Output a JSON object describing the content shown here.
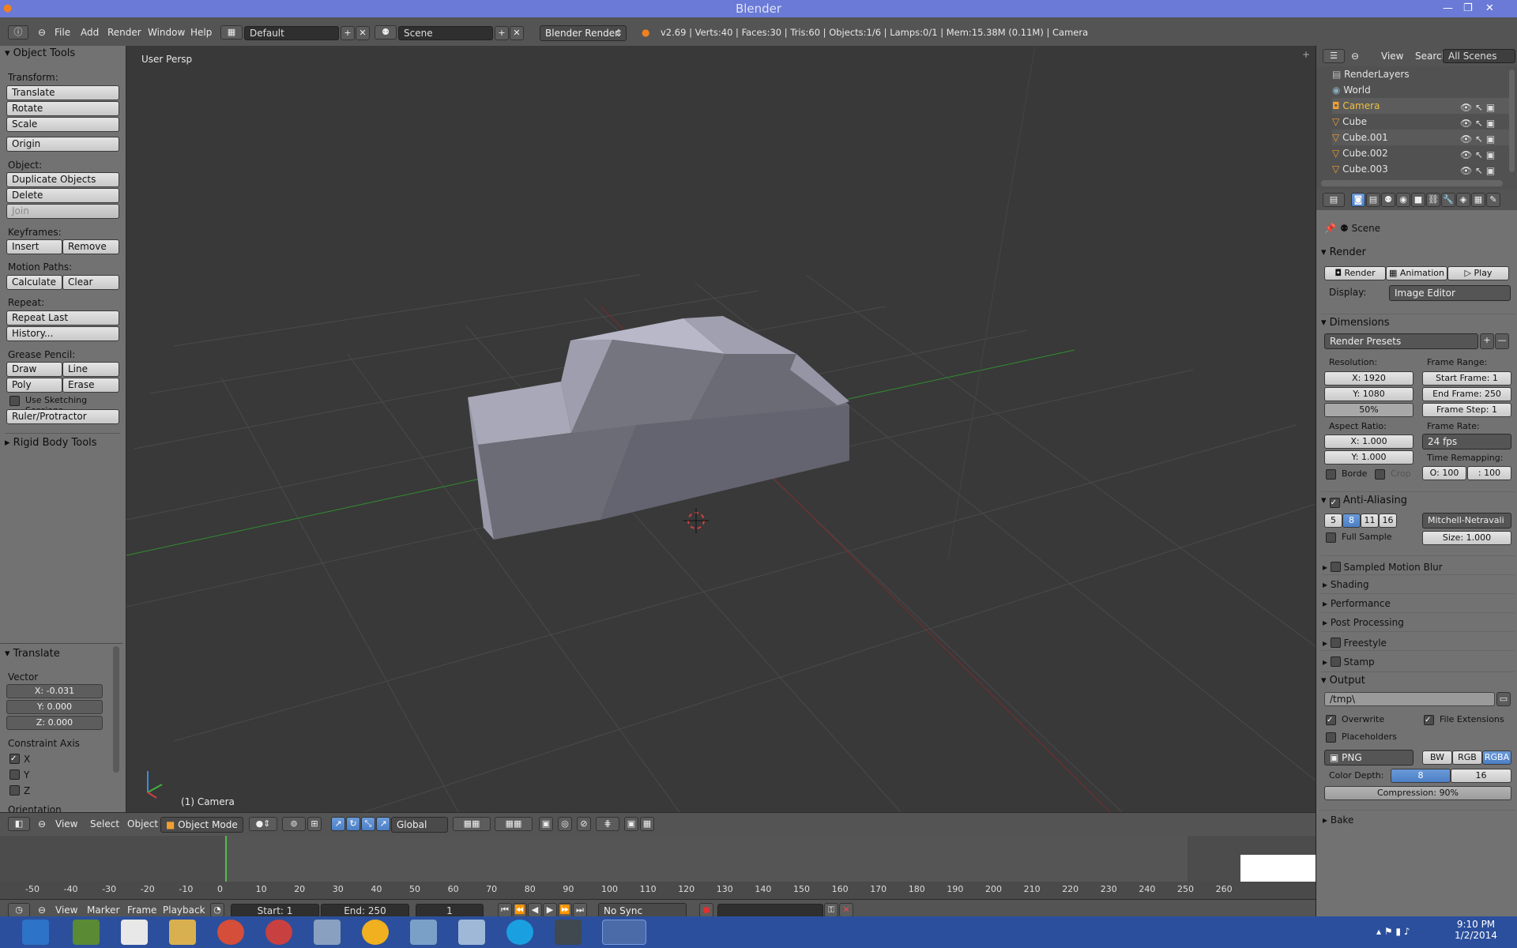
{
  "window": {
    "title": "Blender"
  },
  "infobar": {
    "menus": [
      "File",
      "Add",
      "Render",
      "Window",
      "Help"
    ],
    "layout": "Default",
    "scene": "Scene",
    "engine": "Blender Render",
    "stats": "v2.69 | Verts:40 | Faces:30 | Tris:60 | Objects:1/6 | Lamps:0/1 | Mem:15.38M (0.11M) | Camera"
  },
  "tools": {
    "header": "Object Tools",
    "transform_label": "Transform:",
    "translate": "Translate",
    "rotate": "Rotate",
    "scale": "Scale",
    "origin": "Origin",
    "object_label": "Object:",
    "duplicate": "Duplicate Objects",
    "delete": "Delete",
    "join": "Join",
    "keyframes_label": "Keyframes:",
    "insert": "Insert",
    "remove": "Remove",
    "motion_label": "Motion Paths:",
    "calculate": "Calculate",
    "clear": "Clear",
    "repeat_label": "Repeat:",
    "repeat_last": "Repeat Last",
    "history": "History...",
    "grease_label": "Grease Pencil:",
    "draw": "Draw",
    "line": "Line",
    "poly": "Poly",
    "erase": "Erase",
    "sketching": "Use Sketching Sessions",
    "ruler": "Ruler/Protractor",
    "rigid": "Rigid Body Tools",
    "op_header": "Translate",
    "vector_label": "Vector",
    "vx": "X: -0.031",
    "vy": "Y: 0.000",
    "vz": "Z: 0.000",
    "constraint_label": "Constraint Axis",
    "cx": "X",
    "cy": "Y",
    "cz": "Z",
    "orientation_label": "Orientation"
  },
  "viewport": {
    "view_name": "User Persp",
    "object_label": "(1) Camera"
  },
  "viewbar": {
    "menus": [
      "View",
      "Select",
      "Object"
    ],
    "mode": "Object Mode",
    "orientation": "Global"
  },
  "timeline": {
    "ticks": [
      "-50",
      "-40",
      "-30",
      "-20",
      "-10",
      "0",
      "10",
      "20",
      "30",
      "40",
      "50",
      "60",
      "70",
      "80",
      "90",
      "100",
      "110",
      "120",
      "130",
      "140",
      "150",
      "160",
      "170",
      "180",
      "190",
      "200",
      "210",
      "220",
      "230",
      "240",
      "250",
      "260"
    ]
  },
  "tlbar": {
    "menus": [
      "View",
      "Marker",
      "Frame",
      "Playback"
    ],
    "start": "Start: 1",
    "end": "End: 250",
    "current": "1",
    "sync": "No Sync"
  },
  "outliner": {
    "menus": [
      "View",
      "Search"
    ],
    "scope": "All Scenes",
    "items": [
      "RenderLayers",
      "World",
      "Camera",
      "Cube",
      "Cube.001",
      "Cube.002",
      "Cube.003"
    ]
  },
  "props": {
    "scene": "Scene",
    "render_header": "Render",
    "render_btn": "Render",
    "animation_btn": "Animation",
    "play_btn": "Play",
    "display_label": "Display:",
    "display_value": "Image Editor",
    "dimensions_header": "Dimensions",
    "presets": "Render Presets",
    "resolution_label": "Resolution:",
    "res_x": "X: 1920",
    "res_y": "Y: 1080",
    "res_pct": "50%",
    "frame_range_label": "Frame Range:",
    "start_frame": "Start Frame: 1",
    "end_frame": "End Frame: 250",
    "frame_step": "Frame Step: 1",
    "aspect_label": "Aspect Ratio:",
    "asp_x": "X: 1.000",
    "asp_y": "Y: 1.000",
    "frame_rate_label": "Frame Rate:",
    "fps": "24 fps",
    "remap_label": "Time Remapping:",
    "remap_old": "O: 100",
    "remap_new": ": 100",
    "border": "Borde",
    "crop": "Crop",
    "aa_header": "Anti-Aliasing",
    "aa_samples": [
      "5",
      "8",
      "11",
      "16"
    ],
    "aa_filter": "Mitchell-Netravali",
    "full_sample": "Full Sample",
    "size": "Size: 1.000",
    "panels": [
      "Sampled Motion Blur",
      "Shading",
      "Performance",
      "Post Processing",
      "Freestyle",
      "Stamp"
    ],
    "output_header": "Output",
    "output_path": "/tmp\\",
    "overwrite": "Overwrite",
    "file_ext": "File Extensions",
    "placeholders": "Placeholders",
    "format": "PNG",
    "bw": "BW",
    "rgb": "RGB",
    "rgba": "RGBA",
    "depth_label": "Color Depth:",
    "depth8": "8",
    "depth16": "16",
    "compression": "Compression: 90%",
    "bake_header": "Bake"
  },
  "taskbar": {
    "time": "9:10 PM",
    "date": "1/2/2014"
  }
}
